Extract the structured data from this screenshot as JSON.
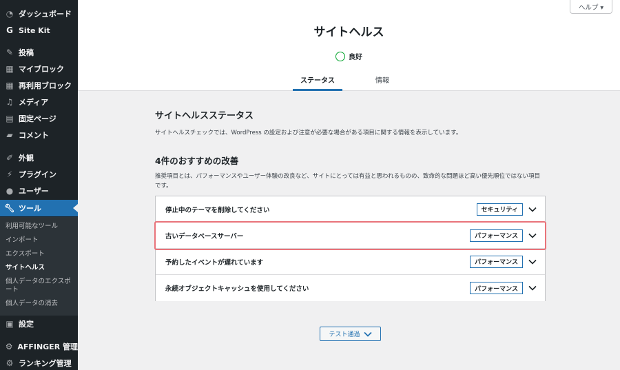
{
  "sidebar": {
    "items": [
      {
        "label": "ダッシュボード",
        "icon": "dashboard-icon"
      },
      {
        "label": "Site Kit",
        "icon": "google-g-icon"
      },
      {
        "label": "投稿",
        "icon": "pin-icon"
      },
      {
        "label": "マイブロック",
        "icon": "grid-icon"
      },
      {
        "label": "再利用ブロック",
        "icon": "grid-icon"
      },
      {
        "label": "メディア",
        "icon": "media-icon"
      },
      {
        "label": "固定ページ",
        "icon": "page-icon"
      },
      {
        "label": "コメント",
        "icon": "comment-icon"
      },
      {
        "label": "外観",
        "icon": "brush-icon"
      },
      {
        "label": "プラグイン",
        "icon": "plugin-icon"
      },
      {
        "label": "ユーザー",
        "icon": "user-icon"
      },
      {
        "label": "ツール",
        "icon": "wrench-icon"
      },
      {
        "label": "設定",
        "icon": "settings-icon"
      },
      {
        "label": "AFFINGER 管理",
        "icon": "gear-icon"
      },
      {
        "label": "ランキング管理",
        "icon": "gear-icon"
      }
    ],
    "submenu": [
      {
        "label": "利用可能なツール"
      },
      {
        "label": "インポート"
      },
      {
        "label": "エクスポート"
      },
      {
        "label": "サイトヘルス"
      },
      {
        "label": "個人データのエクスポート"
      },
      {
        "label": "個人データの消去"
      }
    ]
  },
  "header": {
    "help_label": "ヘルプ ▾",
    "title": "サイトヘルス",
    "status_label": "良好",
    "tabs": [
      {
        "label": "ステータス"
      },
      {
        "label": "情報"
      }
    ]
  },
  "main": {
    "section_title": "サイトヘルスステータス",
    "section_desc": "サイトヘルスチェックでは、WordPress の設定および注意が必要な場合がある項目に関する情報を表示しています。",
    "count_title": "4件のおすすめの改善",
    "rec_desc": "推奨項目とは、パフォーマンスやユーザー体験の改良など、サイトにとっては有益と思われるものの、致命的な問題ほど高い優先順位ではない項目です。",
    "issues": [
      {
        "title": "停止中のテーマを削除してください",
        "badge": "セキュリティ"
      },
      {
        "title": "古いデータベースサーバー",
        "badge": "パフォーマンス"
      },
      {
        "title": "予約したイベントが遅れています",
        "badge": "パフォーマンス"
      },
      {
        "title": "永続オブジェクトキャッシュを使用してください",
        "badge": "パフォーマンス"
      }
    ],
    "passed_label": "テスト通過"
  },
  "colors": {
    "accent": "#2271b1",
    "good": "#00a32a",
    "highlight": "#e9737a",
    "sidebar": "#1d2327"
  }
}
